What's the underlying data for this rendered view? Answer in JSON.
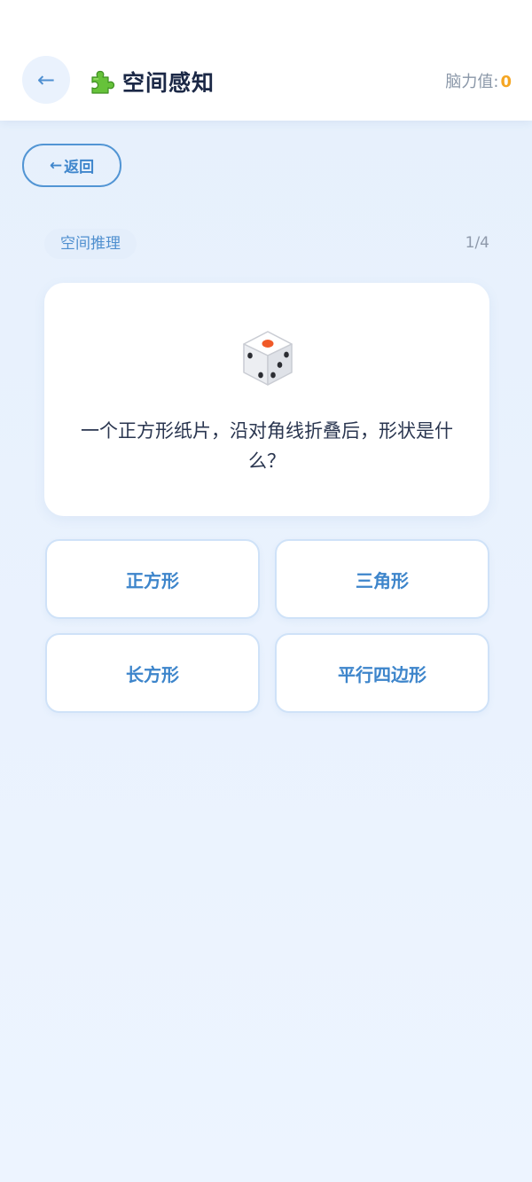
{
  "header": {
    "back_icon": "←",
    "title_icon": "puzzle-piece",
    "title": "空间感知",
    "score_label": "脑力值:",
    "score_value": "0"
  },
  "return_button": {
    "arrow": "←",
    "label": "返回"
  },
  "question": {
    "category": "空间推理",
    "progress": "1/4",
    "illustration_icon": "dice",
    "text": "一个正方形纸片，沿对角线折叠后，形状是什么？"
  },
  "options": [
    {
      "label": "正方形"
    },
    {
      "label": "三角形"
    },
    {
      "label": "长方形"
    },
    {
      "label": "平行四边形"
    }
  ],
  "colors": {
    "accent": "#3d85cb",
    "score": "#f5a623",
    "background": "#e9f2fd",
    "dice_pip_red": "#f05a28"
  }
}
